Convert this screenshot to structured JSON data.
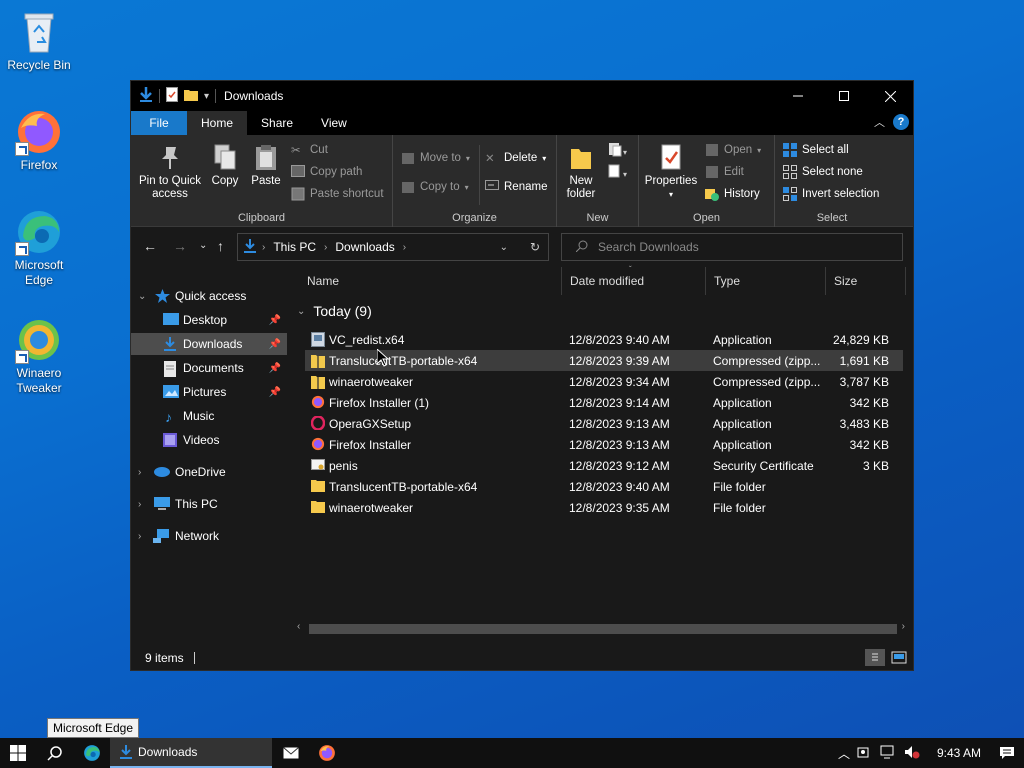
{
  "desktop": {
    "icons": [
      {
        "label": "Recycle Bin"
      },
      {
        "label": "Firefox"
      },
      {
        "label": "Microsoft Edge"
      },
      {
        "label": "Winaero Tweaker"
      }
    ]
  },
  "window": {
    "title": "Downloads",
    "tabs": {
      "file": "File",
      "home": "Home",
      "share": "Share",
      "view": "View"
    },
    "help": "?",
    "ribbon": {
      "clipboard": {
        "name": "Clipboard",
        "pin": "Pin to Quick access",
        "copy": "Copy",
        "paste": "Paste",
        "cut": "Cut",
        "copy_path": "Copy path",
        "paste_shortcut": "Paste shortcut"
      },
      "organize": {
        "name": "Organize",
        "move_to": "Move to",
        "copy_to": "Copy to",
        "delete": "Delete",
        "rename": "Rename"
      },
      "new": {
        "name": "New",
        "new_folder": "New folder"
      },
      "open": {
        "name": "Open",
        "properties": "Properties",
        "open": "Open",
        "edit": "Edit",
        "history": "History"
      },
      "select": {
        "name": "Select",
        "select_all": "Select all",
        "select_none": "Select none",
        "invert": "Invert selection"
      }
    },
    "address": {
      "crumbs": [
        "This PC",
        "Downloads"
      ],
      "search_placeholder": "Search Downloads"
    },
    "nav": {
      "quick_access": "Quick access",
      "items": [
        "Desktop",
        "Downloads",
        "Documents",
        "Pictures",
        "Music",
        "Videos"
      ],
      "onedrive": "OneDrive",
      "this_pc": "This PC",
      "network": "Network"
    },
    "columns": {
      "name": "Name",
      "date": "Date modified",
      "type": "Type",
      "size": "Size"
    },
    "group_header": "Today (9)",
    "files": [
      {
        "name": "VC_redist.x64",
        "date": "12/8/2023 9:40 AM",
        "type": "Application",
        "size": "24,829 KB",
        "icon": "installer-icon"
      },
      {
        "name": "TranslucentTB-portable-x64",
        "date": "12/8/2023 9:39 AM",
        "type": "Compressed (zipp...",
        "size": "1,691 KB",
        "icon": "zip-icon"
      },
      {
        "name": "winaerotweaker",
        "date": "12/8/2023 9:34 AM",
        "type": "Compressed (zipp...",
        "size": "3,787 KB",
        "icon": "zip-icon"
      },
      {
        "name": "Firefox Installer (1)",
        "date": "12/8/2023 9:14 AM",
        "type": "Application",
        "size": "342 KB",
        "icon": "firefox-icon"
      },
      {
        "name": "OperaGXSetup",
        "date": "12/8/2023 9:13 AM",
        "type": "Application",
        "size": "3,483 KB",
        "icon": "opera-icon"
      },
      {
        "name": "Firefox Installer",
        "date": "12/8/2023 9:13 AM",
        "type": "Application",
        "size": "342 KB",
        "icon": "firefox-icon"
      },
      {
        "name": "penis",
        "date": "12/8/2023 9:12 AM",
        "type": "Security Certificate",
        "size": "3 KB",
        "icon": "certificate-icon"
      },
      {
        "name": "TranslucentTB-portable-x64",
        "date": "12/8/2023 9:40 AM",
        "type": "File folder",
        "size": "",
        "icon": "folder-icon"
      },
      {
        "name": "winaerotweaker",
        "date": "12/8/2023 9:35 AM",
        "type": "File folder",
        "size": "",
        "icon": "folder-icon"
      }
    ],
    "status": "9 items"
  },
  "taskbar": {
    "active_app": "Downloads",
    "time": "9:43 AM",
    "tooltip": "Microsoft Edge"
  },
  "colors": {
    "accent": "#1979ca",
    "window_bg": "#191919",
    "ribbon_bg": "#2b2b2b"
  }
}
